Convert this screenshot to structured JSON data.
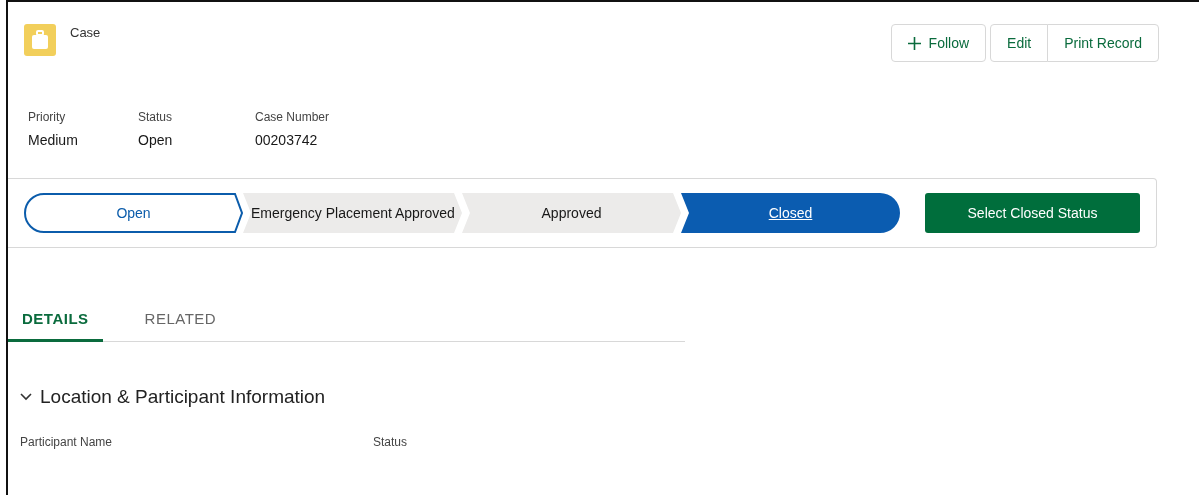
{
  "record": {
    "object_label": "Case"
  },
  "actions": [
    {
      "kind": "follow",
      "label": "Follow"
    },
    {
      "kind": "group",
      "label": "Edit"
    },
    {
      "kind": "group",
      "label": "Print Record"
    }
  ],
  "highlights": [
    {
      "label": "Priority",
      "value": "Medium"
    },
    {
      "label": "Status",
      "value": "Open"
    },
    {
      "label": "Case Number",
      "value": "00203742"
    }
  ],
  "path": {
    "stages": [
      {
        "label": "Open",
        "current": true,
        "selected": false
      },
      {
        "label": "Emergency Placement Approved",
        "current": false,
        "selected": false
      },
      {
        "label": "Approved",
        "current": false,
        "selected": false
      },
      {
        "label": "Closed",
        "current": false,
        "selected": true
      }
    ],
    "action_button": "Select Closed Status"
  },
  "tabs": [
    {
      "label": "DETAILS",
      "selected": true
    },
    {
      "label": "RELATED",
      "selected": false
    }
  ],
  "section": {
    "title": "Location & Participant Information",
    "expanded": true,
    "fields": [
      {
        "label": "Participant Name"
      },
      {
        "label": "Status"
      }
    ]
  }
}
